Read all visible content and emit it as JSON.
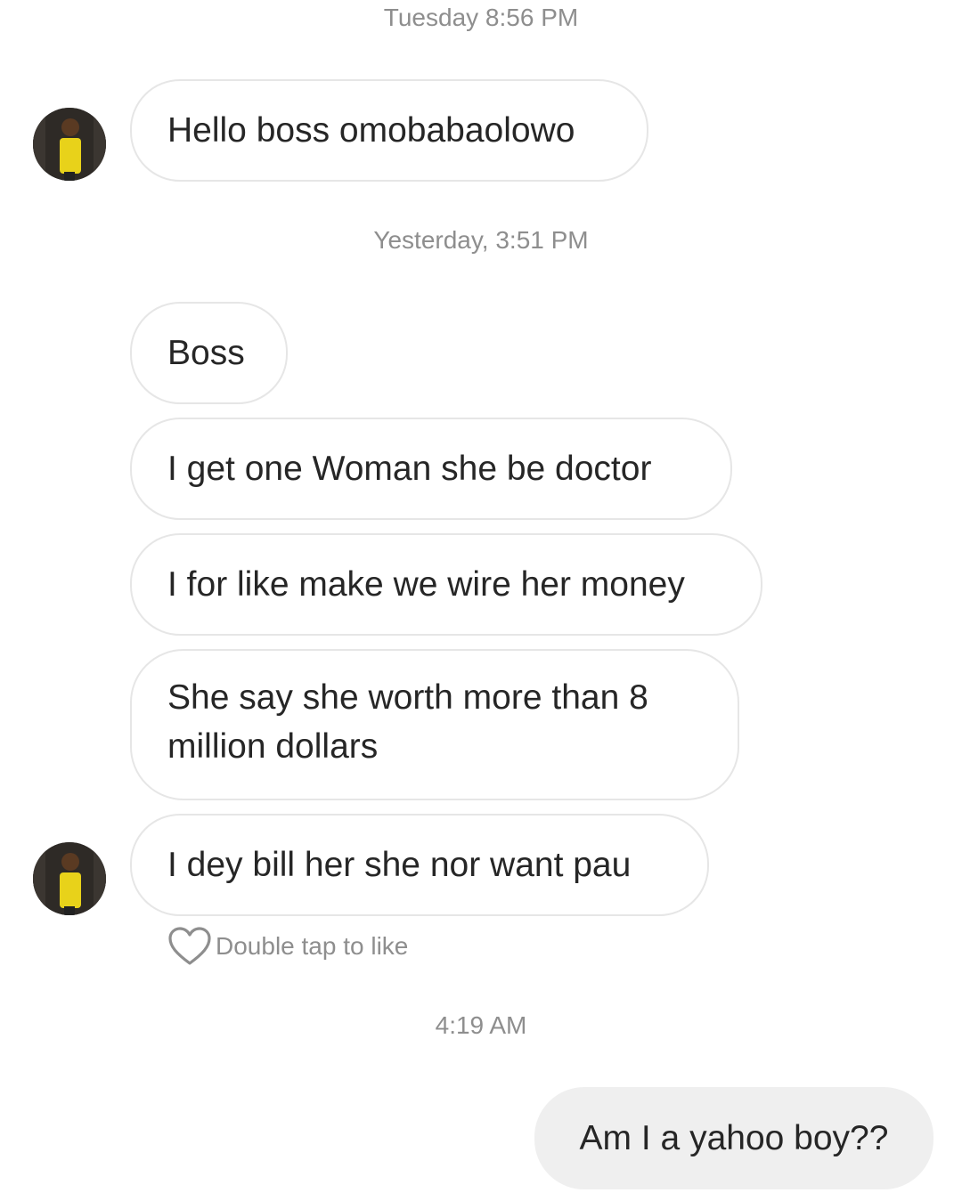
{
  "timestamps": {
    "t1": "Tuesday 8:56 PM",
    "t2": "Yesterday, 3:51 PM",
    "t3": "4:19 AM"
  },
  "messages": [
    {
      "text": "Hello boss omobabaolowo",
      "sender": "other"
    },
    {
      "text": "Boss",
      "sender": "other"
    },
    {
      "text": "I get one Woman she be doctor",
      "sender": "other"
    },
    {
      "text": "I for like make we wire her money",
      "sender": "other"
    },
    {
      "text": "She say she worth more than 8 million dollars",
      "sender": "other"
    },
    {
      "text": "I dey bill her she nor want pau",
      "sender": "other"
    },
    {
      "text": "Am I a yahoo boy??",
      "sender": "me"
    }
  ],
  "like_hint": {
    "label": "Double tap to like",
    "icon": "heart-outline-icon"
  },
  "colors": {
    "timestamp": "#8e8e8e",
    "bubble_border": "#e6e6e6",
    "my_bubble_bg": "#efefef",
    "text": "#262626"
  }
}
